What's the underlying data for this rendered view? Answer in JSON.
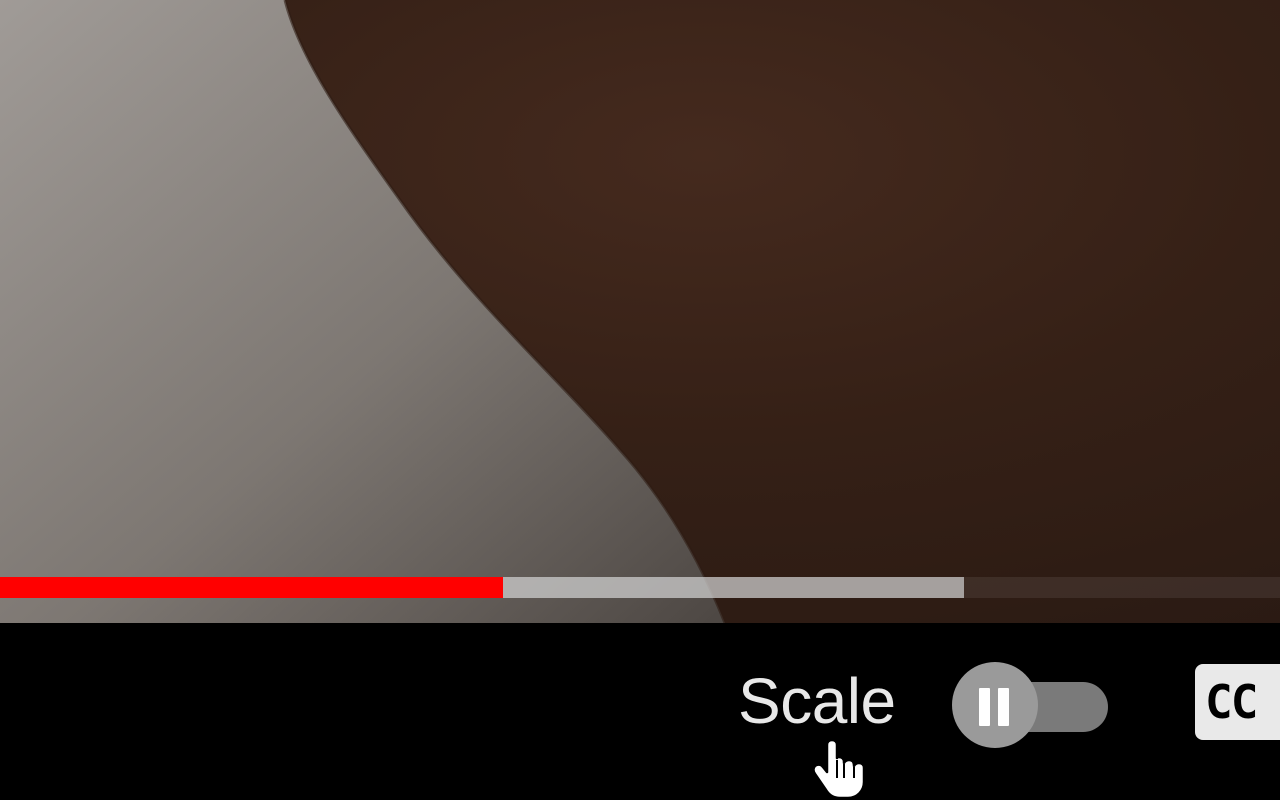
{
  "video": {
    "progress_played": 0.393,
    "progress_buffered": 0.753
  },
  "controls": {
    "scale_label": "Scale",
    "autoplay_toggle": {
      "state": "on",
      "knob_icon": "pause-icon"
    },
    "captions_label": "CC"
  },
  "cursor": {
    "icon": "hand-pointer-icon"
  },
  "colors": {
    "progress_played": "#ff0000",
    "progress_buffered": "#cdcdcd",
    "controls_background": "#000000",
    "label_text": "#e8e8e8"
  }
}
